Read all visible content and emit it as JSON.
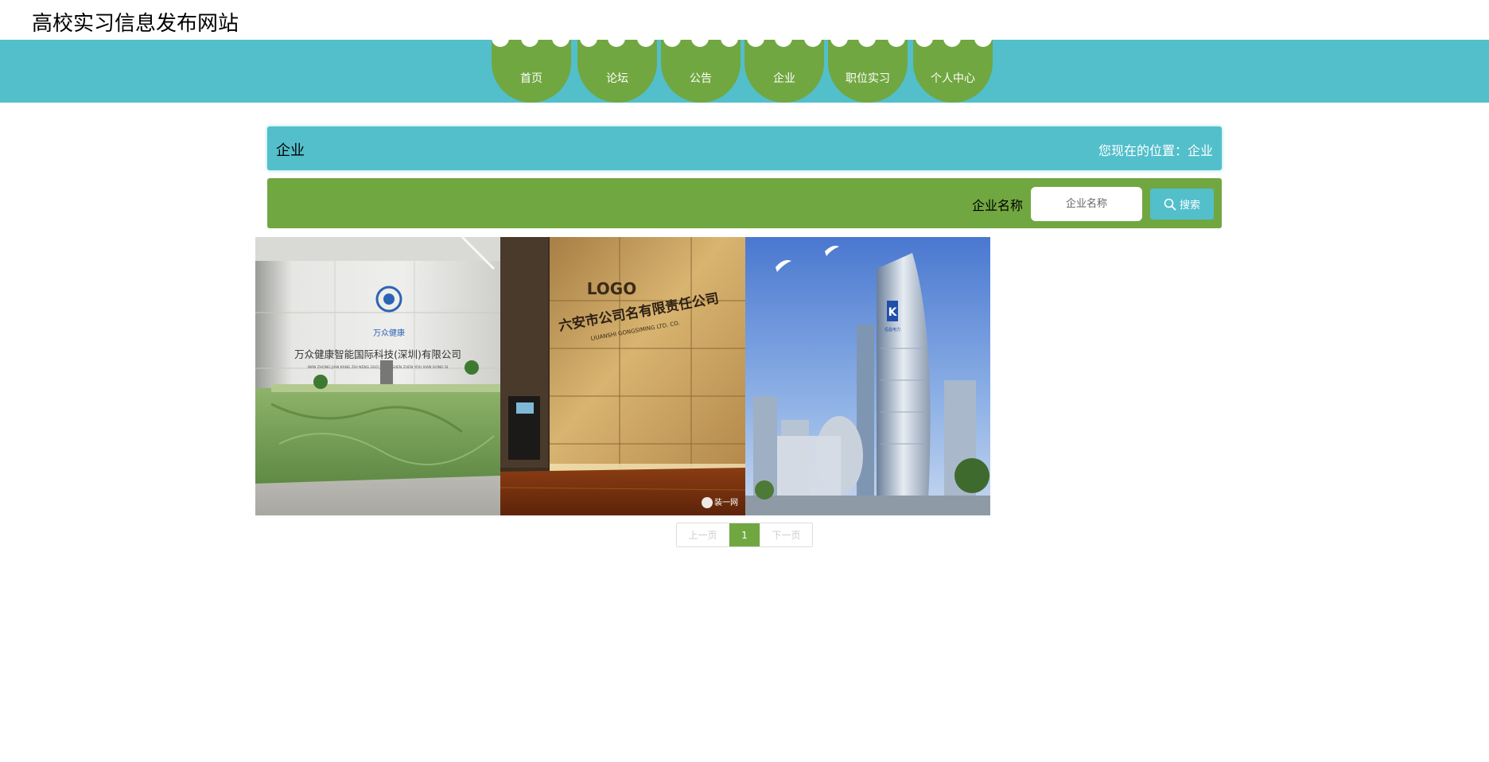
{
  "header": {
    "site_title": "高校实习信息发布网站"
  },
  "nav": {
    "items": [
      {
        "label": "首页"
      },
      {
        "label": "论坛"
      },
      {
        "label": "公告"
      },
      {
        "label": "企业"
      },
      {
        "label": "职位实习"
      },
      {
        "label": "个人中心"
      }
    ]
  },
  "page": {
    "title": "企业",
    "breadcrumb": "您现在的位置：企业"
  },
  "search": {
    "label": "企业名称",
    "placeholder": "企业名称",
    "button_label": "搜索",
    "button_icon": "search-icon"
  },
  "companies": [
    {
      "sign_cn": "万众健康智能国际科技(深圳)有限公司",
      "sign_en": "WAN ZHONG JIAN KANG ZHI NENG GUO JI KE JI SHEN ZHEN YOU XIAN GONG SI",
      "logo_caption": "万众健康"
    },
    {
      "sign_logo": "LOGO",
      "sign_cn": "六安市公司名有限责任公司",
      "sign_en": "LIUANSHI GONGSIMING LTD. CO.",
      "watermark": "装一网"
    },
    {
      "building_sign": "K",
      "building_caption": "恒昌电力"
    }
  ],
  "pagination": {
    "prev": "上一页",
    "current": "1",
    "next": "下一页"
  },
  "colors": {
    "teal": "#52bfcb",
    "green": "#71a741"
  }
}
